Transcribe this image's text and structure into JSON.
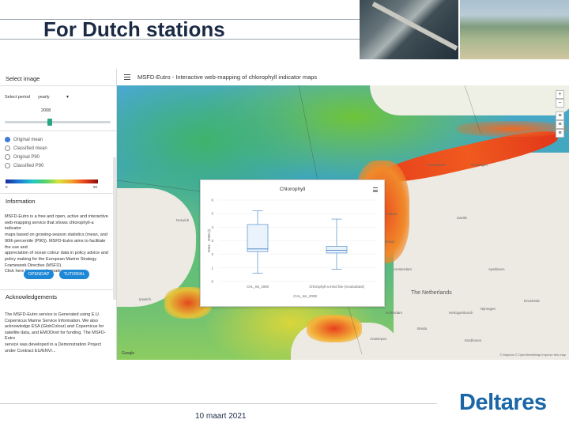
{
  "slide": {
    "title": "For Dutch stations",
    "date": "10 maart 2021",
    "logo_text": "Deltares"
  },
  "app": {
    "title": "MSFD-Eutro - Interactive web-mapping of chlorophyll indicator maps",
    "sidebar": {
      "select_image_heading": "Select image",
      "select_period_label": "Select period",
      "period_value": "yearly",
      "year_value": "2008",
      "slider_fraction": 0.42,
      "radio_options": [
        {
          "label": "Original mean",
          "selected": true
        },
        {
          "label": "Classified mean",
          "selected": false
        },
        {
          "label": "Original P90",
          "selected": false
        },
        {
          "label": "Classified P90",
          "selected": false
        }
      ],
      "colorbar": {
        "min": "0",
        "max": "50"
      },
      "information_heading": "Information",
      "information_text": [
        "MSFD-Eutro is a free and open, active and interactive",
        "web-mapping service that shows chlorophyll-a indicator",
        "maps based on growing-season statistics (mean, and",
        "90th percentile (P90)). MSFD-Eutro aims to facilitate the use and",
        "appreciation of ocean colour data in policy advice and",
        "policy making for the European Marine Strategy",
        "Framework Directive (MSFD).",
        "Click here for more information"
      ],
      "buttons": {
        "opendap": "OPENDAP",
        "tutorial": "TUTORIAL"
      },
      "acknowledgements_heading": "Acknowledgements",
      "acknowledgements_text": [
        "The MSFD-Eutro service is Generated using E.U.",
        "Copernicus Marine Service Information. We also",
        "acknowledge ESA (GlobColour) and Copernicus for",
        "satellite data, and EMODnet for funding. The MSFD-Eutro",
        "service was developed in a Demonstration Project",
        "under Contract EU/ENV/..."
      ]
    },
    "map": {
      "zoom_in": "+",
      "zoom_out": "−",
      "places": [
        "Leeuwarden",
        "Groningen",
        "Den Helder",
        "Alkmaar",
        "Amsterdam",
        "Zwolle",
        "The Netherlands",
        "Den Haag",
        "Rotterdam",
        "Ipswich",
        "Norwich",
        "Antwerpen",
        "Breda",
        "Eindhoven",
        "Apeldoorn",
        "Enschede",
        "Hertogenbosch",
        "Nijmegen"
      ],
      "attribution": "© Mapbox © OpenStreetMap Improve this map",
      "google_logo": "Google"
    },
    "popup": {
      "title": "Chlorophyll",
      "ylabel": "2004 - 2008 (t)"
    }
  },
  "chart_data": {
    "type": "box",
    "title": "Chlorophyll",
    "ylabel": "2004 - 2008 (t)",
    "ylim": [
      0,
      6
    ],
    "yticks": [
      0,
      1,
      2,
      3,
      4,
      5,
      6
    ],
    "categories": [
      "CHL_tss_2008",
      "Chlorophyll-a trend line (recalculated)"
    ],
    "xlabel": "CHL_tss_2008",
    "boxes": [
      {
        "min": 0.6,
        "q1": 2.2,
        "median": 2.4,
        "q3": 4.2,
        "max": 5.2
      },
      {
        "min": 0.9,
        "q1": 2.1,
        "median": 2.3,
        "q3": 2.6,
        "max": 4.6
      }
    ]
  }
}
